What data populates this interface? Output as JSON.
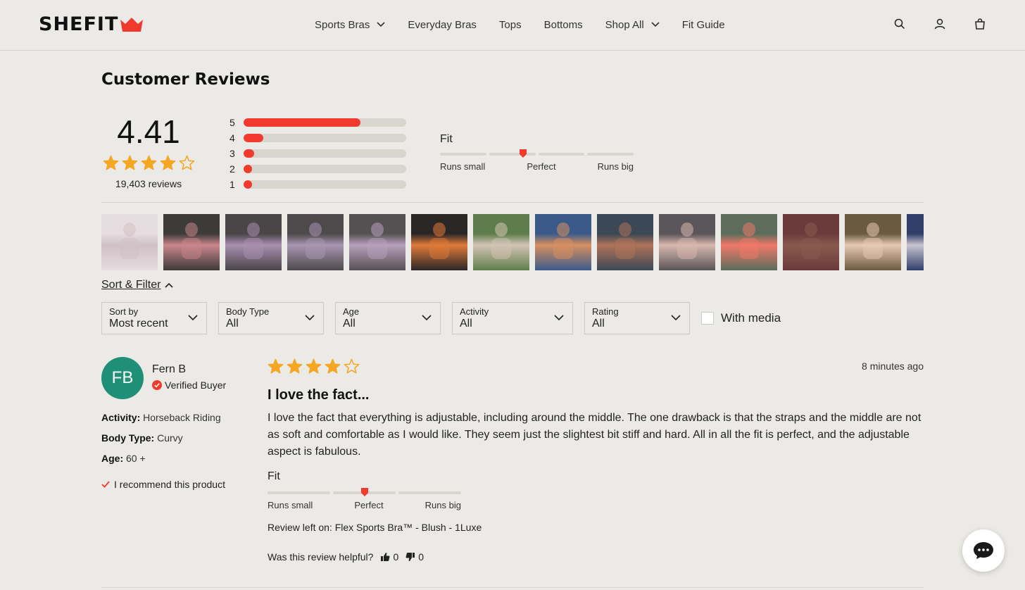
{
  "header": {
    "logo_text": "SHEFIT",
    "nav": [
      {
        "label": "Sports Bras",
        "dropdown": true
      },
      {
        "label": "Everyday Bras",
        "dropdown": false
      },
      {
        "label": "Tops",
        "dropdown": false
      },
      {
        "label": "Bottoms",
        "dropdown": false
      },
      {
        "label": "Shop All",
        "dropdown": true
      },
      {
        "label": "Fit Guide",
        "dropdown": false
      }
    ],
    "icons": [
      "search-icon",
      "account-icon",
      "cart-icon"
    ]
  },
  "reviews_section": {
    "title": "Customer Reviews",
    "average": "4.41",
    "average_stars": 4.41,
    "review_count": "19,403 reviews",
    "distribution": [
      {
        "stars": "5",
        "fraction": 0.72
      },
      {
        "stars": "4",
        "fraction": 0.12
      },
      {
        "stars": "3",
        "fraction": 0.065
      },
      {
        "stars": "2",
        "fraction": 0.035
      },
      {
        "stars": "1",
        "fraction": 0.05
      }
    ],
    "fit": {
      "title": "Fit",
      "labels": [
        "Runs small",
        "Perfect",
        "Runs big"
      ],
      "position": 0.43
    }
  },
  "media_count": 14,
  "sort_filter": {
    "toggle_label": "Sort & Filter",
    "filters": [
      {
        "label": "Sort by",
        "value": "Most recent"
      },
      {
        "label": "Body Type",
        "value": "All"
      },
      {
        "label": "Age",
        "value": "All"
      },
      {
        "label": "Activity",
        "value": "All"
      },
      {
        "label": "Rating",
        "value": "All"
      }
    ],
    "with_media_label": "With media"
  },
  "review": {
    "initials": "FB",
    "name": "Fern B",
    "verified_label": "Verified Buyer",
    "activity_label": "Activity:",
    "activity": "Horseback Riding",
    "body_type_label": "Body Type:",
    "body_type": "Curvy",
    "age_label": "Age:",
    "age": "60 +",
    "recommend": "I recommend this product",
    "rating": 4,
    "date": "8 minutes ago",
    "title": "I love the fact...",
    "body": "I love the fact that everything is adjustable, including around the middle. The one drawback is that the straps and the middle are not as soft and comfortable as I would like. They seem just the slightest bit stiff and hard. All in all the fit is perfect, and the adjustable aspect is fabulous.",
    "fit_title": "Fit",
    "fit_labels": [
      "Runs small",
      "Perfect",
      "Runs big"
    ],
    "fit_position": 0.5,
    "product": "Review left on: Flex Sports Bra™ - Blush - 1Luxe",
    "helpful_label": "Was this review helpful?",
    "helpful_yes": "0",
    "helpful_no": "0"
  },
  "colors": {
    "accent": "#F03A2E",
    "star": "#F5A623",
    "avatar": "#1F8F76",
    "background": "#ECEAE6"
  }
}
